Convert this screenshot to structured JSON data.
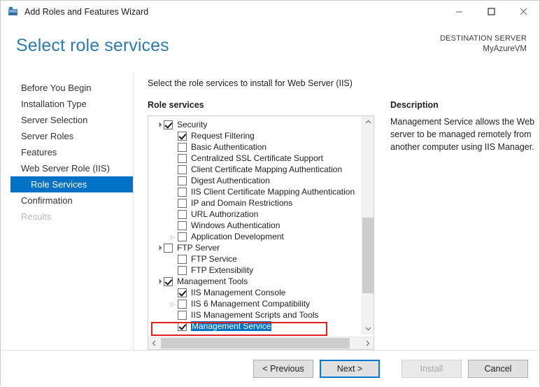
{
  "window": {
    "title": "Add Roles and Features Wizard",
    "icon": "server-wizard-icon",
    "controls": {
      "minimize": "minimize-icon",
      "maximize": "maximize-icon",
      "close": "close-icon"
    }
  },
  "header": {
    "page_title": "Select role services",
    "destination_label": "DESTINATION SERVER",
    "destination_value": "MyAzureVM"
  },
  "nav": {
    "items": [
      {
        "label": "Before You Begin",
        "state": "normal",
        "level": 0
      },
      {
        "label": "Installation Type",
        "state": "normal",
        "level": 0
      },
      {
        "label": "Server Selection",
        "state": "normal",
        "level": 0
      },
      {
        "label": "Server Roles",
        "state": "normal",
        "level": 0
      },
      {
        "label": "Features",
        "state": "normal",
        "level": 0
      },
      {
        "label": "Web Server Role (IIS)",
        "state": "normal",
        "level": 0
      },
      {
        "label": "Role Services",
        "state": "selected",
        "level": 1
      },
      {
        "label": "Confirmation",
        "state": "normal",
        "level": 0
      },
      {
        "label": "Results",
        "state": "disabled",
        "level": 0
      }
    ]
  },
  "content": {
    "instruction": "Select the role services to install for Web Server (IIS)",
    "role_services_heading": "Role services",
    "tree": [
      {
        "label": "Security",
        "indent": 0,
        "checked": true,
        "expander": "expanded",
        "selected": false
      },
      {
        "label": "Request Filtering",
        "indent": 1,
        "checked": true,
        "expander": "none",
        "selected": false
      },
      {
        "label": "Basic Authentication",
        "indent": 1,
        "checked": false,
        "expander": "none",
        "selected": false
      },
      {
        "label": "Centralized SSL Certificate Support",
        "indent": 1,
        "checked": false,
        "expander": "none",
        "selected": false
      },
      {
        "label": "Client Certificate Mapping Authentication",
        "indent": 1,
        "checked": false,
        "expander": "none",
        "selected": false
      },
      {
        "label": "Digest Authentication",
        "indent": 1,
        "checked": false,
        "expander": "none",
        "selected": false
      },
      {
        "label": "IIS Client Certificate Mapping Authentication",
        "indent": 1,
        "checked": false,
        "expander": "none",
        "selected": false
      },
      {
        "label": "IP and Domain Restrictions",
        "indent": 1,
        "checked": false,
        "expander": "none",
        "selected": false
      },
      {
        "label": "URL Authorization",
        "indent": 1,
        "checked": false,
        "expander": "none",
        "selected": false
      },
      {
        "label": "Windows Authentication",
        "indent": 1,
        "checked": false,
        "expander": "none",
        "selected": false
      },
      {
        "label": "Application Development",
        "indent": 1,
        "checked": false,
        "expander": "collapsed",
        "selected": false
      },
      {
        "label": "FTP Server",
        "indent": 0,
        "checked": false,
        "expander": "expanded",
        "selected": false
      },
      {
        "label": "FTP Service",
        "indent": 1,
        "checked": false,
        "expander": "none",
        "selected": false
      },
      {
        "label": "FTP Extensibility",
        "indent": 1,
        "checked": false,
        "expander": "none",
        "selected": false
      },
      {
        "label": "Management Tools",
        "indent": 0,
        "checked": true,
        "expander": "expanded",
        "selected": false
      },
      {
        "label": "IIS Management Console",
        "indent": 1,
        "checked": true,
        "expander": "none",
        "selected": false
      },
      {
        "label": "IIS 6 Management Compatibility",
        "indent": 1,
        "checked": false,
        "expander": "collapsed",
        "selected": false
      },
      {
        "label": "IIS Management Scripts and Tools",
        "indent": 1,
        "checked": false,
        "expander": "none",
        "selected": false
      },
      {
        "label": "Management Service",
        "indent": 1,
        "checked": true,
        "expander": "none",
        "selected": true
      }
    ],
    "highlight_color": "#e02020",
    "selection_color": "#0072c6"
  },
  "description": {
    "heading": "Description",
    "text": "Management Service allows the Web server to be managed remotely from another computer using IIS Manager."
  },
  "footer": {
    "previous": "< Previous",
    "next": "Next >",
    "install": "Install",
    "cancel": "Cancel"
  },
  "scrollbars": {
    "vertical_up": "chevron-up-icon",
    "vertical_down": "chevron-down-icon",
    "horizontal_left": "chevron-left-icon",
    "horizontal_right": "chevron-right-icon"
  }
}
